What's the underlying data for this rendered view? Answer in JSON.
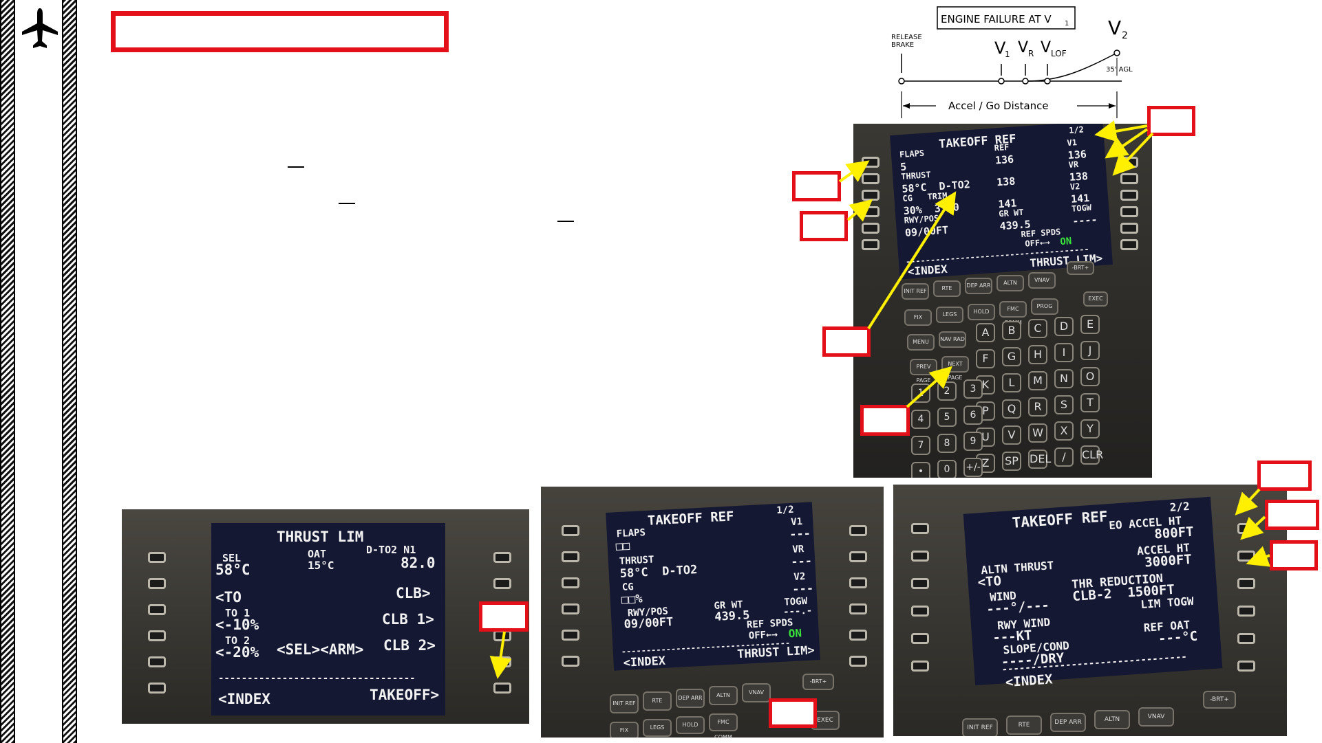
{
  "diagram": {
    "title": "ENGINE FAILURE AT V",
    "title_sub": "1",
    "release_brake_1": "RELEASE",
    "release_brake_2": "BRAKE",
    "v": "V",
    "v1_sub": "1",
    "vr_sub": "R",
    "vlof_sub": "LOF",
    "v2_sub": "2",
    "agl": "35' AGL",
    "distance": "Accel / Go Distance"
  },
  "cdu_main": {
    "title": "TAKEOFF REF",
    "page": "1/2",
    "rows": [
      {
        "left": "FLAPS",
        "center": "REF",
        "right": "V1"
      },
      {
        "left": "5",
        "center": "136",
        "right": "136"
      },
      {
        "left": "THRUST",
        "center": "",
        "right": "VR"
      },
      {
        "left": "58°C  D-TO2",
        "center": "138",
        "right": "138"
      },
      {
        "left": "CG   TRIM",
        "center": "",
        "right": "V2"
      },
      {
        "left": "30%  3.00",
        "center": "141",
        "right": "141"
      },
      {
        "left": "RWY/POS",
        "center": "GR WT",
        "right": "TOGW"
      },
      {
        "left": "09/00FT",
        "center": "439.5",
        "right": "----"
      }
    ],
    "ref_spds": "REF SPDS",
    "off": "OFF←→",
    "on": "ON",
    "bottom_left": "<INDEX",
    "bottom_right": "THRUST LIM>",
    "keys_row1": [
      "INIT REF",
      "RTE",
      "DEP ARR",
      "ALTN",
      "VNAV"
    ],
    "keys_row2": [
      "FIX",
      "LEGS",
      "HOLD",
      "FMC COMM",
      "PROG"
    ],
    "keys_row3": [
      "MENU",
      "NAV RAD"
    ],
    "keys_row4": [
      "PREV PAGE",
      "NEXT PAGE"
    ],
    "exec": "EXEC",
    "brt": "-BRT+",
    "alpha": [
      "A",
      "B",
      "C",
      "D",
      "E",
      "F",
      "G",
      "H",
      "I",
      "J",
      "K",
      "L",
      "M",
      "N",
      "O",
      "P",
      "Q",
      "R",
      "S",
      "T",
      "U",
      "V",
      "W",
      "X",
      "Y",
      "Z",
      "SP",
      "DEL",
      "/",
      "CLR"
    ],
    "nums": [
      "1",
      "2",
      "3",
      "4",
      "5",
      "6",
      "7",
      "8",
      "9",
      "•",
      "0",
      "+/-"
    ]
  },
  "cdu_thrust": {
    "title": "THRUST LIM",
    "sel": "SEL",
    "oat": "OAT",
    "mode": "D-TO2 N1",
    "sel_val": "58°C",
    "oat_val": "15°C",
    "n1": "82.0",
    "to": "<TO",
    "clb": "CLB>",
    "to1": "TO 1",
    "to1_val": "<-10%",
    "clb1": "CLB 1>",
    "to2": "TO 2",
    "to2_val": "<-20%",
    "selarm": "<SEL><ARM>",
    "clb2": "CLB 2>",
    "index": "<INDEX",
    "takeoff": "TAKEOFF>"
  },
  "cdu_blank": {
    "title": "TAKEOFF REF",
    "page": "1/2",
    "flaps": "FLAPS",
    "flaps_val": "□□",
    "v1": "V1",
    "v1_val": "---",
    "thrust": "THRUST",
    "thrust_val": "58°C  D-TO2",
    "vr": "VR",
    "vr_val": "---",
    "cg": "CG",
    "cg_val": "□□%",
    "v2": "V2",
    "v2_val": "---",
    "rwy": "RWY/POS",
    "rwy_val": "09/00FT",
    "grwt": "GR WT",
    "grwt_val": "439.5",
    "togw": "TOGW",
    "togw_val": "---.-",
    "ref_spds": "REF SPDS",
    "off": "OFF←→",
    "on": "ON",
    "index": "<INDEX",
    "thrust_lim": "THRUST LIM>",
    "keys": [
      "INIT REF",
      "RTE",
      "DEP ARR",
      "ALTN",
      "VNAV"
    ],
    "keys2": [
      "FIX",
      "LEGS",
      "HOLD",
      "FMC COMM"
    ],
    "brt": "-BRT+",
    "exec": "EXEC"
  },
  "cdu_page2": {
    "title": "TAKEOFF REF",
    "page": "2/2",
    "eo": "EO ACCEL HT",
    "eo_val": "800FT",
    "accel": "ACCEL HT",
    "accel_val": "3000FT",
    "altn": "ALTN THRUST",
    "to": "<TO",
    "thr_red": "THR REDUCTION",
    "wind": "WIND",
    "thr_val": "CLB-2  1500FT",
    "wind_val": "---°/---",
    "lim": "LIM TOGW",
    "rwy_wind": "RWY WIND",
    "kt": "---KT",
    "ref_oat": "REF OAT",
    "slope": "SLOPE/COND",
    "dry": "----/DRY",
    "deg": "---°C",
    "index": "<INDEX",
    "keys": [
      "INIT REF",
      "RTE",
      "DEP ARR",
      "ALTN",
      "VNAV"
    ],
    "brt": "-BRT+"
  },
  "colors": {
    "callout": "#e3101a",
    "arrow": "#ffef00",
    "screen": "#141833",
    "on": "#39e23a"
  }
}
